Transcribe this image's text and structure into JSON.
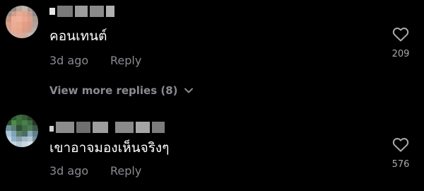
{
  "comments": [
    {
      "text": "คอนเทนต์",
      "time": "3d ago",
      "reply_label": "Reply",
      "likes": "209",
      "view_more": {
        "label": "View more replies (8)"
      }
    },
    {
      "text": "เขาอาจมองเห็นจริงๆ",
      "time": "3d ago",
      "reply_label": "Reply",
      "likes": "576"
    }
  ],
  "icons": {
    "like": "heart-outline-icon",
    "expand": "chevron-down-icon"
  },
  "colors": {
    "background": "#000000",
    "primary_text": "#ffffff",
    "secondary_text": "#8a8b91",
    "like_count": "#a8a9ad"
  }
}
